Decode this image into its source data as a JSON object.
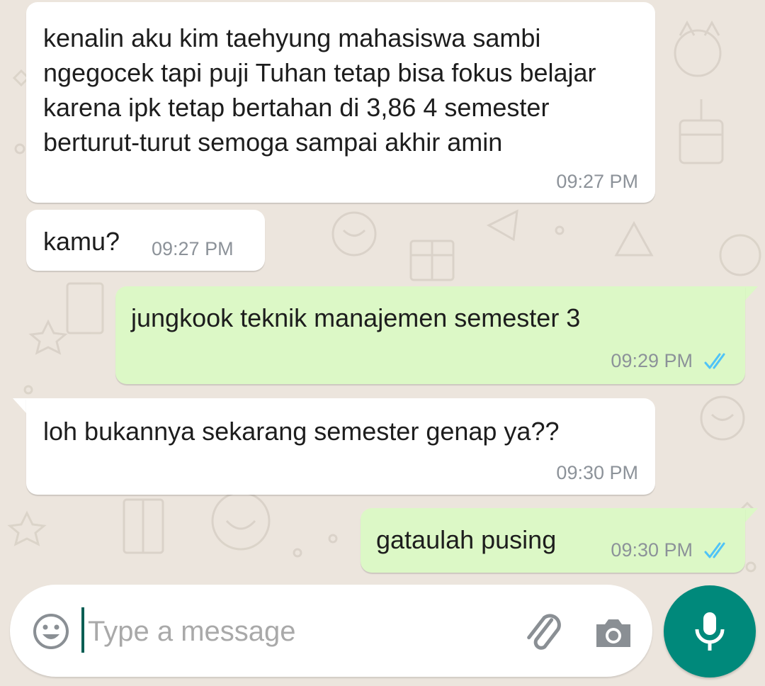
{
  "messages": [
    {
      "direction": "incoming",
      "text": "kenalin aku kim taehyung mahasiswa sambi ngegocek tapi puji Tuhan tetap bisa fokus belajar karena ipk tetap bertahan di 3,86 4 semester berturut-turut semoga sampai akhir amin",
      "time": "09:27 PM"
    },
    {
      "direction": "incoming",
      "text": "kamu?",
      "time": "09:27 PM"
    },
    {
      "direction": "outgoing",
      "text": "jungkook teknik manajemen semester 3",
      "time": "09:29 PM",
      "status": "read"
    },
    {
      "direction": "incoming",
      "text": "loh bukannya sekarang semester genap ya??",
      "time": "09:30 PM"
    },
    {
      "direction": "outgoing",
      "text": "gataulah pusing",
      "time": "09:30 PM",
      "status": "read"
    }
  ],
  "composer": {
    "placeholder": "Type a message",
    "icons": [
      "emoji-icon",
      "paperclip-icon",
      "camera-icon",
      "microphone-icon"
    ]
  },
  "colors": {
    "wallpaper": "#ece5dd",
    "incoming_bubble": "#ffffff",
    "outgoing_bubble": "#dcf8c6",
    "read_ticks": "#4fc3f7",
    "mic_button": "#00897b",
    "timestamp": "#8c9299"
  }
}
